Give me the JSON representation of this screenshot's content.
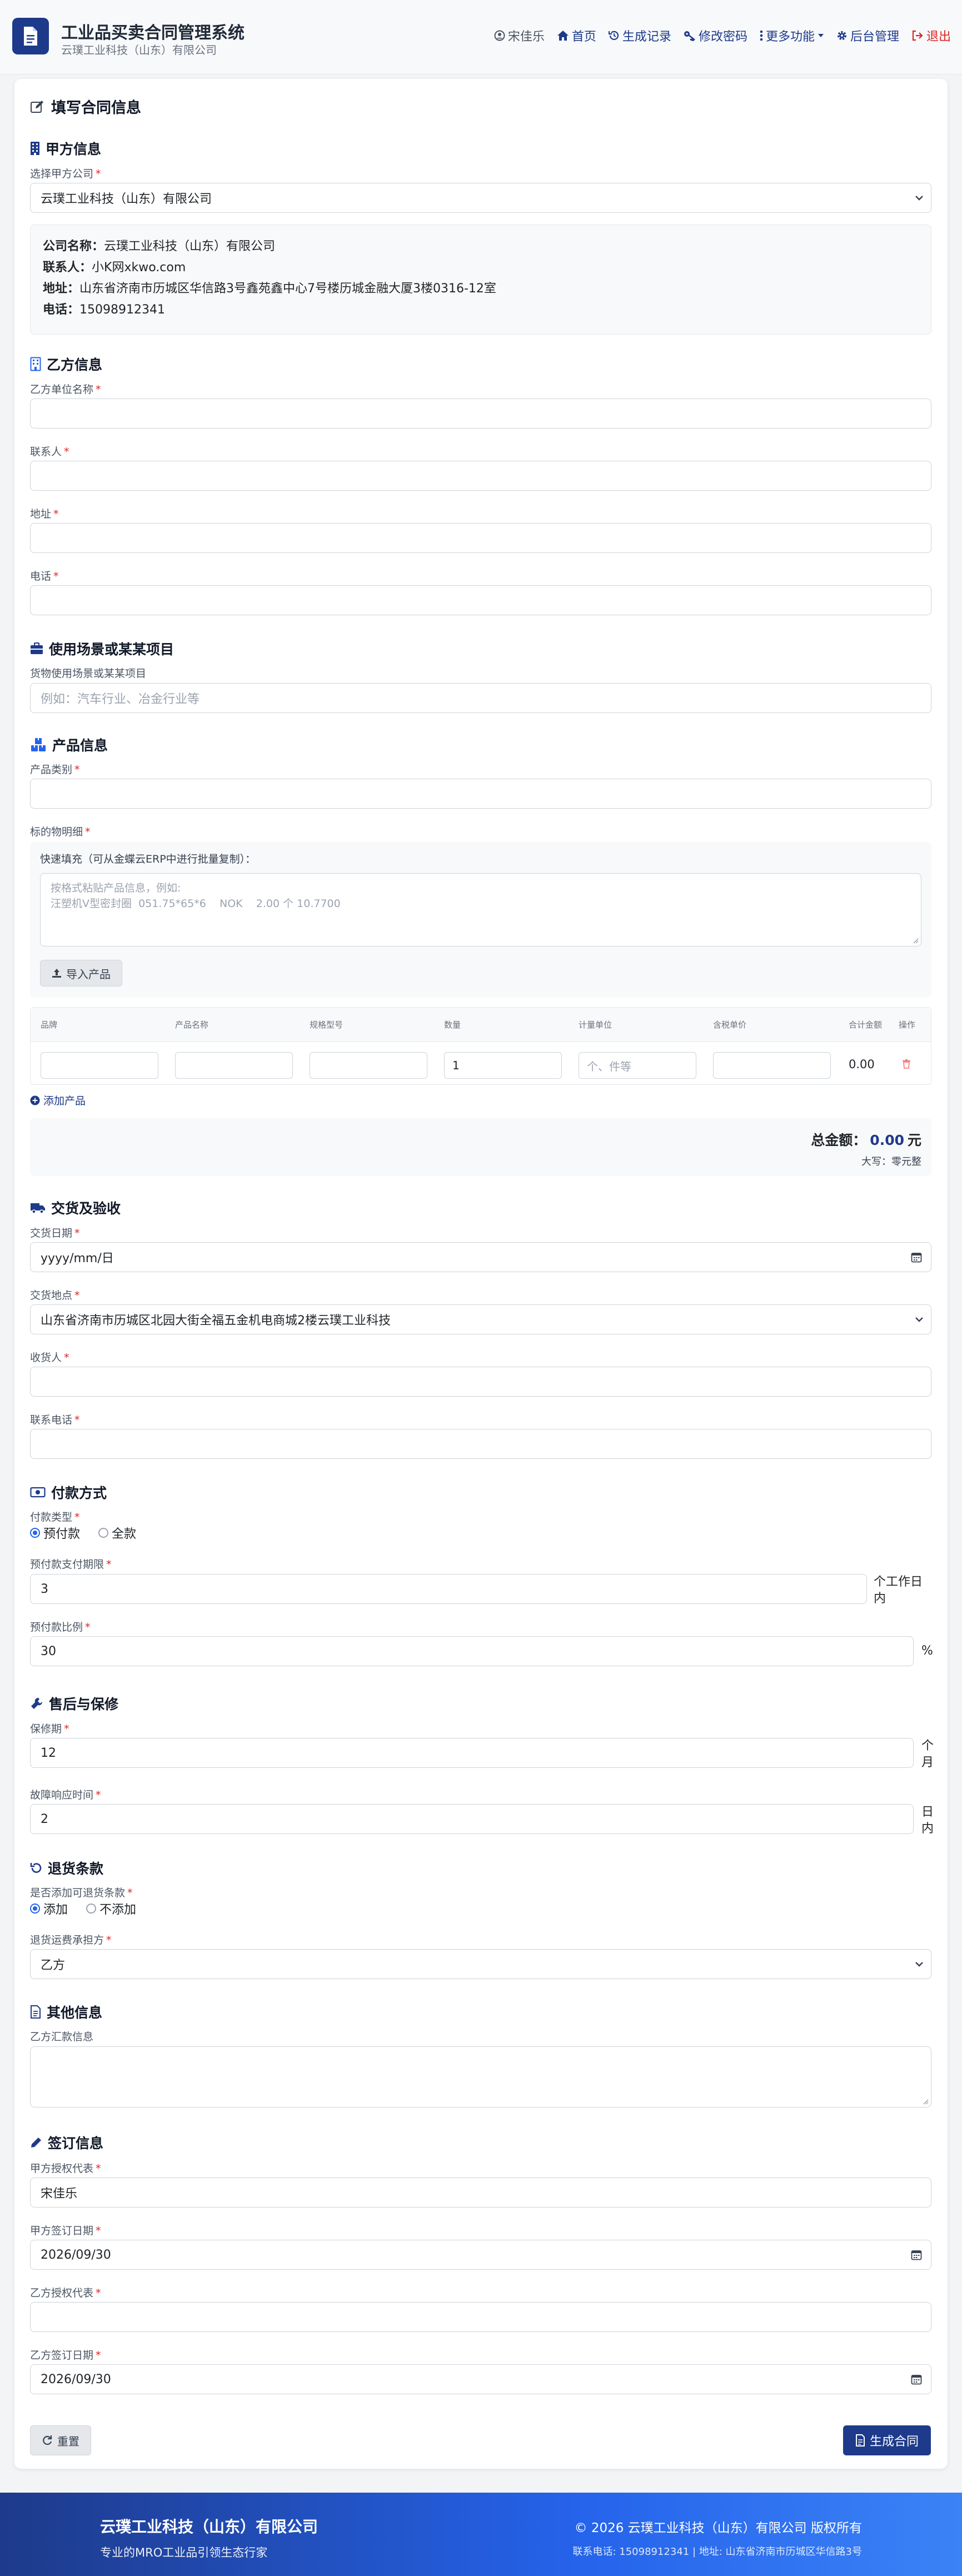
{
  "header": {
    "title": "工业品买卖合同管理系统",
    "subtitle": "云璞工业科技（山东）有限公司",
    "nav": {
      "user": "宋佳乐",
      "home": "首页",
      "records": "生成记录",
      "password": "修改密码",
      "more": "更多功能",
      "admin": "后台管理",
      "logout": "退出"
    }
  },
  "form": {
    "title": "填写合同信息",
    "party_a": {
      "section": "甲方信息",
      "select_label": "选择甲方公司",
      "selected": "云璞工业科技（山东）有限公司",
      "info": {
        "company_k": "公司名称：",
        "company_v": "云璞工业科技（山东）有限公司",
        "contact_k": "联系人：",
        "contact_v": "小K网xkwo.com",
        "address_k": "地址：",
        "address_v": "山东省济南市历城区华信路3号鑫苑鑫中心7号楼历城金融大厦3楼0316-12室",
        "phone_k": "电话：",
        "phone_v": "15098912341"
      }
    },
    "party_b": {
      "section": "乙方信息",
      "name_label": "乙方单位名称",
      "contact_label": "联系人",
      "address_label": "地址",
      "phone_label": "电话"
    },
    "scene": {
      "section": "使用场景或某某项目",
      "label": "货物使用场景或某某项目",
      "placeholder": "例如：汽车行业、冶金行业等"
    },
    "product": {
      "section": "产品信息",
      "category_label": "产品类别",
      "detail_label": "标的物明细",
      "quick_label": "快速填充（可从金蝶云ERP中进行批量复制）：",
      "quick_ph1": "按格式粘贴产品信息，例如:",
      "quick_ph2": "汪塑机V型密封圈  051.75*65*6    NOK    2.00 个 10.7700",
      "import_btn": "导入产品",
      "columns": [
        "品牌",
        "产品名称",
        "规格型号",
        "数量",
        "计量单位",
        "含税单价",
        "合计金额",
        "操作"
      ],
      "row": {
        "qty": "1",
        "unit_ph": "个、件等",
        "subtotal": "0.00"
      },
      "add_btn": "添加产品",
      "total_label": "总金额：",
      "total_value": "0.00",
      "total_unit": "元",
      "capital_label": "大写：",
      "capital_value": "零元整"
    },
    "delivery": {
      "section": "交货及验收",
      "date_label": "交货日期",
      "date_value": "yyyy/mm/日",
      "place_label": "交货地点",
      "place_value": "山东省济南市历城区北园大街全福五金机电商城2楼云璞工业科技",
      "receiver_label": "收货人",
      "phone_label": "联系电话"
    },
    "payment": {
      "section": "付款方式",
      "type_label": "付款类型",
      "opt1": "预付款",
      "opt2": "全款",
      "term_label": "预付款支付期限",
      "term_value": "3",
      "term_suffix1": "个工作日",
      "term_suffix2": "内",
      "ratio_label": "预付款比例",
      "ratio_value": "30",
      "ratio_suffix": "%"
    },
    "warranty": {
      "section": "售后与保修",
      "period_label": "保修期",
      "period_value": "12",
      "period_suffix1": "个",
      "period_suffix2": "月",
      "response_label": "故障响应时间",
      "response_value": "2",
      "response_suffix1": "日",
      "response_suffix2": "内"
    },
    "returns": {
      "section": "退货条款",
      "add_label": "是否添加可退货条款",
      "opt1": "添加",
      "opt2": "不添加",
      "freight_label": "退货运费承担方",
      "freight_value": "乙方"
    },
    "other": {
      "section": "其他信息",
      "bank_label": "乙方汇款信息"
    },
    "sign": {
      "section": "签订信息",
      "a_rep_label": "甲方授权代表",
      "a_rep_value": "宋佳乐",
      "a_date_label": "甲方签订日期",
      "a_date_value": "2026/09/30",
      "b_rep_label": "乙方授权代表",
      "b_date_label": "乙方签订日期",
      "b_date_value": "2026/09/30"
    },
    "reset_btn": "重置",
    "submit_btn": "生成合同"
  },
  "footer": {
    "company": "云璞工业科技（山东）有限公司",
    "slogan": "专业的MRO工业品引领生态行家",
    "copyright": "© 2026 云璞工业科技（山东）有限公司 版权所有",
    "contact": "联系电话: 15098912341 | 地址: 山东省济南市历城区华信路3号"
  },
  "colors": {
    "primary": "#1e3a8a",
    "accent": "#2563eb",
    "danger": "#dc2626",
    "required": "#dc2626"
  }
}
